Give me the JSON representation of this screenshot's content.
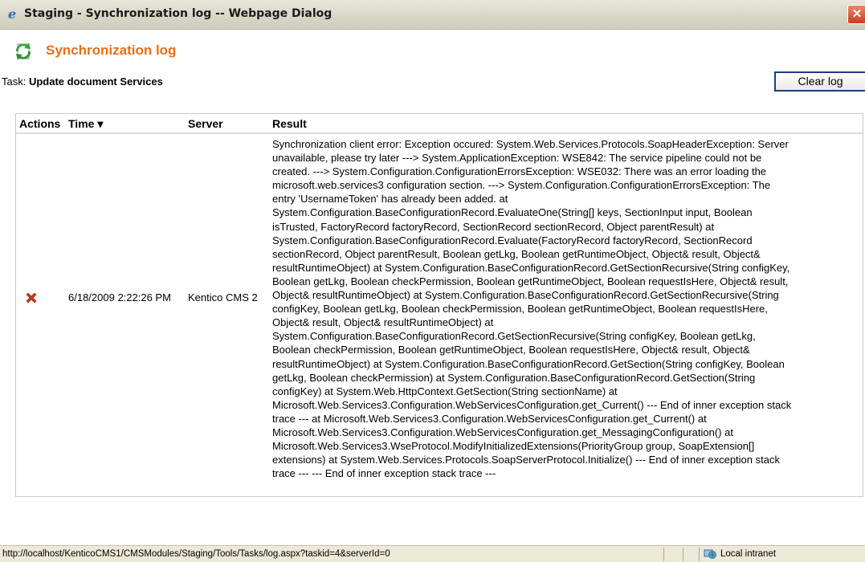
{
  "window": {
    "title": "Staging - Synchronization log -- Webpage Dialog",
    "close_glyph": "✕"
  },
  "header": {
    "title": "Synchronization log"
  },
  "task": {
    "label": "Task: ",
    "value": "Update document Services"
  },
  "toolbar": {
    "clear_log_label": "Clear log"
  },
  "table": {
    "columns": {
      "actions": "Actions",
      "time": "Time ▾",
      "server": "Server",
      "result": "Result"
    },
    "rows": [
      {
        "time": "6/18/2009 2:22:26 PM",
        "server": "Kentico CMS 2",
        "result_lines": [
          "Synchronization client error: Exception occured: System.Web.Services.Protocols.SoapHeaderException: Server",
          "unavailable, please try later ---> System.ApplicationException: WSE842: The service pipeline could not be",
          "created. ---> System.Configuration.ConfigurationErrorsException: WSE032: There was an error loading the",
          "microsoft.web.services3 configuration section. ---> System.Configuration.ConfigurationErrorsException: The",
          "entry 'UsernameToken' has already been added. at",
          "System.Configuration.BaseConfigurationRecord.EvaluateOne(String[] keys, SectionInput input, Boolean",
          "isTrusted, FactoryRecord factoryRecord, SectionRecord sectionRecord, Object parentResult) at",
          "System.Configuration.BaseConfigurationRecord.Evaluate(FactoryRecord factoryRecord, SectionRecord",
          "sectionRecord, Object parentResult, Boolean getLkg, Boolean getRuntimeObject, Object& result, Object&",
          "resultRuntimeObject) at System.Configuration.BaseConfigurationRecord.GetSectionRecursive(String configKey,",
          "Boolean getLkg, Boolean checkPermission, Boolean getRuntimeObject, Boolean requestIsHere, Object& result,",
          "Object& resultRuntimeObject) at System.Configuration.BaseConfigurationRecord.GetSectionRecursive(String",
          "configKey, Boolean getLkg, Boolean checkPermission, Boolean getRuntimeObject, Boolean requestIsHere,",
          "Object& result, Object& resultRuntimeObject) at",
          "System.Configuration.BaseConfigurationRecord.GetSectionRecursive(String configKey, Boolean getLkg,",
          "Boolean checkPermission, Boolean getRuntimeObject, Boolean requestIsHere, Object& result, Object&",
          "resultRuntimeObject) at System.Configuration.BaseConfigurationRecord.GetSection(String configKey, Boolean",
          "getLkg, Boolean checkPermission) at System.Configuration.BaseConfigurationRecord.GetSection(String",
          "configKey) at System.Web.HttpContext.GetSection(String sectionName) at",
          "Microsoft.Web.Services3.Configuration.WebServicesConfiguration.get_Current() --- End of inner exception stack",
          "trace --- at Microsoft.Web.Services3.Configuration.WebServicesConfiguration.get_Current() at",
          "Microsoft.Web.Services3.Configuration.WebServicesConfiguration.get_MessagingConfiguration() at",
          "Microsoft.Web.Services3.WseProtocol.ModifyInitializedExtensions(PriorityGroup group, SoapExtension[]",
          "extensions) at System.Web.Services.Protocols.SoapServerProtocol.Initialize() --- End of inner exception stack",
          "trace --- --- End of inner exception stack trace ---"
        ]
      }
    ]
  },
  "statusbar": {
    "url": "http://localhost/KenticoCMS1/CMSModules/Staging/Tools/Tasks/log.aspx?taskid=4&serverId=0",
    "zone": "Local intranet"
  },
  "colors": {
    "title_accent": "#e86f14",
    "delete_icon": "#c8381c",
    "button_border": "#1a3f7a"
  },
  "icons": {
    "window": "ie-icon",
    "header": "sync-icon",
    "row_action": "delete-icon",
    "zone": "local-intranet-icon"
  }
}
